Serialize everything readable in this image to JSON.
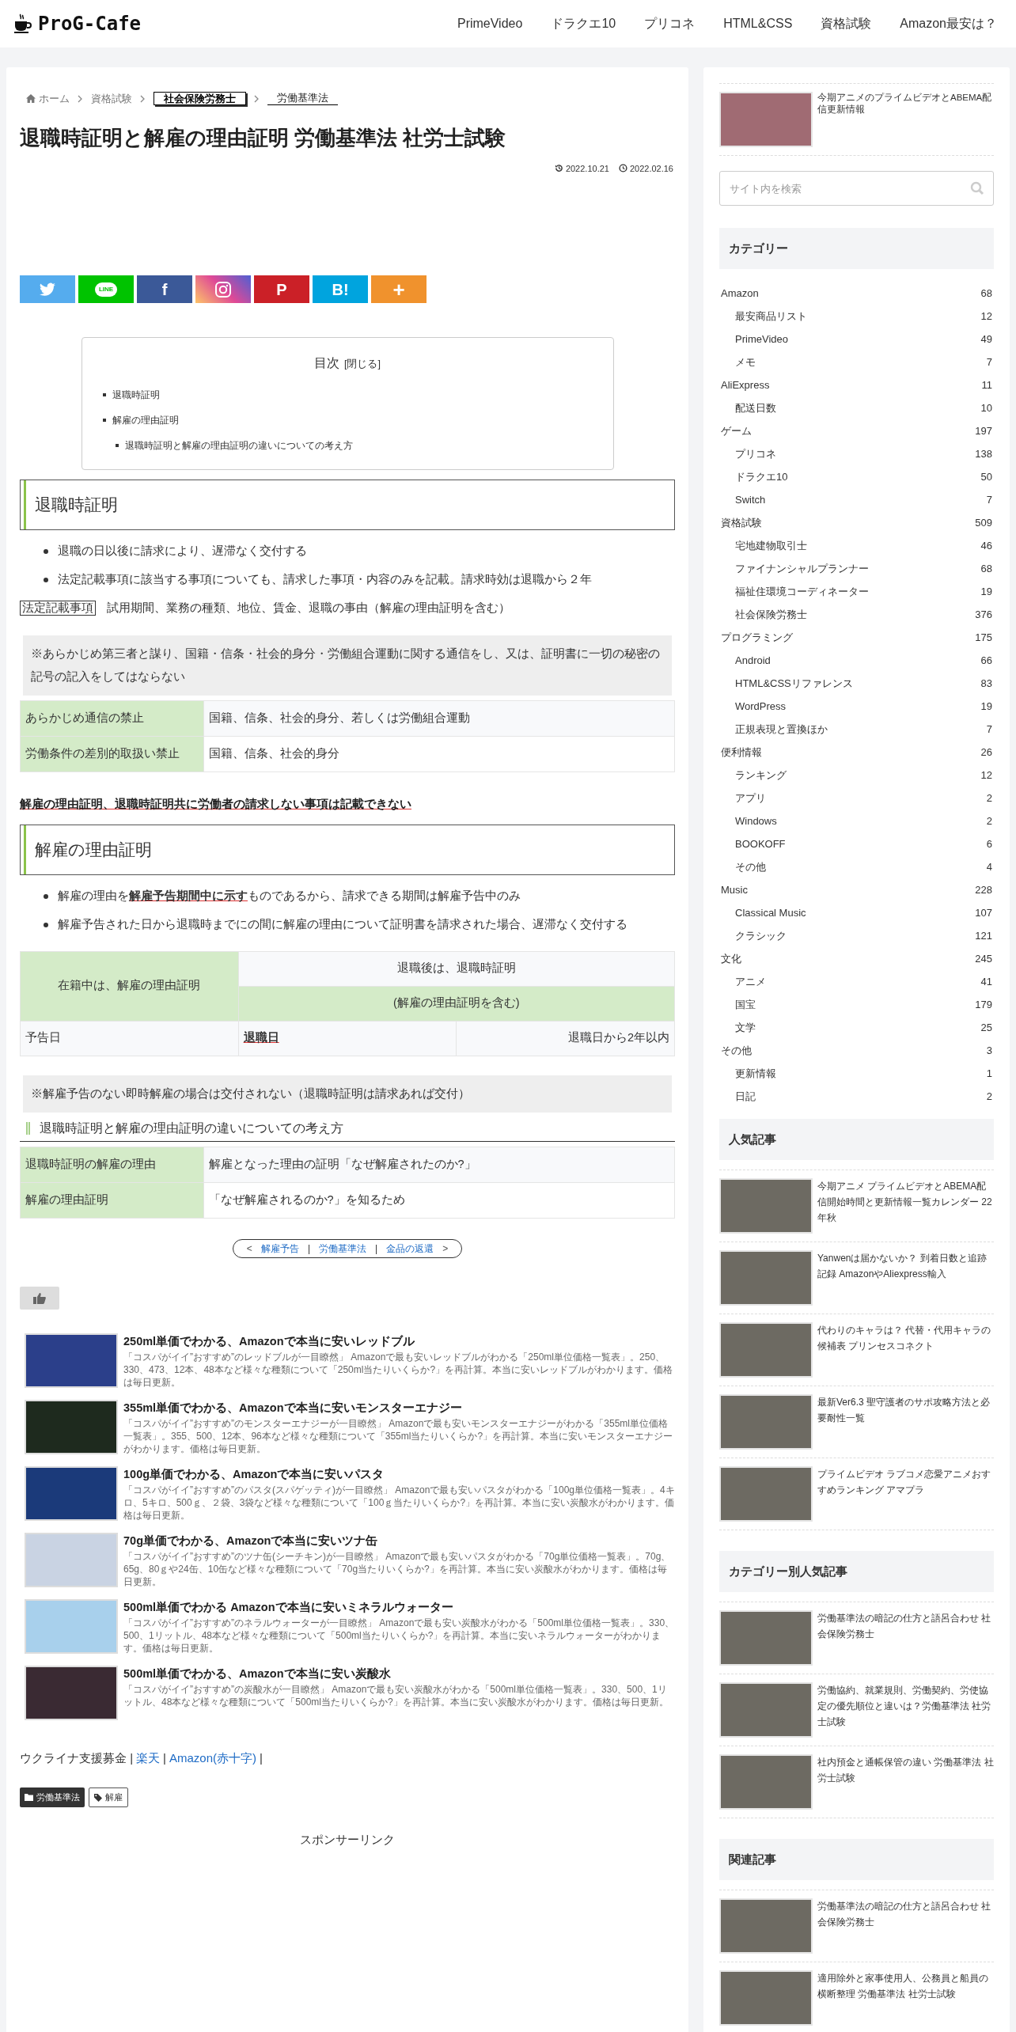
{
  "header": {
    "logo": "ProG-Cafe",
    "nav": [
      "PrimeVideo",
      "ドラクエ10",
      "プリコネ",
      "HTML&CSS",
      "資格試験",
      "Amazon最安は？"
    ]
  },
  "breadcrumb": [
    {
      "kind": "home",
      "label": "ホーム"
    },
    {
      "kind": "link",
      "label": "資格試験"
    },
    {
      "kind": "boxed",
      "label": "社会保険労務士"
    },
    {
      "kind": "underlined",
      "label": "労働基準法"
    }
  ],
  "title": "退職時証明と解雇の理由証明 労働基準法 社労士試験",
  "updated": "2022.10.21",
  "published": "2022.02.16",
  "share": [
    {
      "kind": "twitter"
    },
    {
      "kind": "line",
      "label": "LINE"
    },
    {
      "kind": "facebook",
      "label": "f"
    },
    {
      "kind": "instagram"
    },
    {
      "kind": "pinterest",
      "label": "P"
    },
    {
      "kind": "hatena",
      "label": "B!"
    },
    {
      "kind": "more",
      "label": "+"
    }
  ],
  "toc": {
    "title": "目次",
    "toggle": "[閉じる]",
    "items": [
      {
        "text": "退職時証明"
      },
      {
        "text": "解雇の理由証明",
        "children": [
          {
            "text": "退職時証明と解雇の理由証明の違いについての考え方"
          }
        ]
      }
    ]
  },
  "blocks": [
    {
      "kind": "h2",
      "text": "退職時証明"
    },
    {
      "kind": "bullets",
      "items": [
        "退職の日以後に請求により、遅滞なく交付する",
        "法定記載事項に該当する事項についても、請求した事項・内容のみを記載。請求時効は退職から２年"
      ]
    },
    {
      "kind": "labeled",
      "label": "法定記載事項",
      "text": "試用期間、業務の種類、地位、賃金、退職の事由（解雇の理由証明を含む）"
    },
    {
      "kind": "note",
      "text": "※あらかじめ第三者と謀り、国籍・信条・社会的身分・労働組合運動に関する通信をし、又は、証明書に一切の秘密の記号の記入をしてはならない"
    },
    {
      "kind": "table",
      "rows": [
        [
          "あらかじめ通信の禁止",
          "国籍、信条、社会的身分、若しくは労働組合運動"
        ],
        [
          "労働条件の差別的取扱い禁止",
          "国籍、信条、社会的身分"
        ]
      ]
    },
    {
      "kind": "emphasis",
      "text": "解雇の理由証明、退職時証明共に労働者の請求しない事項は記載できない"
    },
    {
      "kind": "h2",
      "text": "解雇の理由証明"
    },
    {
      "kind": "bullets",
      "items": [
        "解雇の理由を**解雇予告期間中に示す**ものであるから、請求できる期間は解雇予告中のみ",
        "解雇予告された日から退職時までにの間に解雇の理由について証明書を請求された場合、遅滞なく交付する"
      ]
    },
    {
      "kind": "span_table",
      "during": "在籍中は、解雇の理由証明",
      "after": "退職後は、退職時証明",
      "after_note": "(解雇の理由証明を含む)",
      "row": [
        "予告日",
        "退職日",
        "退職日から2年以内"
      ]
    },
    {
      "kind": "note",
      "text": "※解雇予告のない即時解雇の場合は交付されない（退職時証明は請求あれば交付）"
    },
    {
      "kind": "h3",
      "text": "退職時証明と解雇の理由証明の違いについての考え方"
    },
    {
      "kind": "table",
      "rows": [
        [
          "退職時証明の解雇の理由",
          "解雇となった理由の証明「なぜ解雇されたのか?」"
        ],
        [
          "解雇の理由証明",
          "「なぜ解雇されるのか?」を知るため"
        ]
      ]
    }
  ],
  "pager": [
    {
      "kind": "arrow",
      "text": "<"
    },
    {
      "kind": "link",
      "text": "解雇予告"
    },
    {
      "kind": "sep",
      "text": "|"
    },
    {
      "kind": "link",
      "text": "労働基準法"
    },
    {
      "kind": "sep",
      "text": "|"
    },
    {
      "kind": "link",
      "text": "金品の返還"
    },
    {
      "kind": "arrow",
      "text": ">"
    }
  ],
  "products": [
    {
      "title": "250ml単価でわかる、Amazonで本当に安いレッドブル",
      "description": "「コスパがイイ”おすすめ”のレッドブルが一目瞭然」 Amazonで最も安いレッドブルがわかる「250ml単位価格一覧表」。250、330、473、12本、48本など様々な種類について「250ml当たりいくらか?」を再計算。本当に安いレッドブルがわかります。価格は毎日更新。"
    },
    {
      "title": "355ml単価でわかる、Amazonで本当に安いモンスターエナジー",
      "description": "「コスパがイイ”おすすめ”のモンスターエナジーが一目瞭然」 Amazonで最も安いモンスターエナジーがわかる「355ml単位価格一覧表」。355、500、12本、96本など様々な種類について「355ml当たりいくらか?」を再計算。本当に安いモンスターエナジーがわかります。価格は毎日更新。"
    },
    {
      "title": "100g単価でわかる、Amazonで本当に安いパスタ",
      "description": "「コスパがイイ”おすすめ”のパスタ(スパゲッティ)が一目瞭然」 Amazonで最も安いパスタがわかる「100g単位価格一覧表」。4キロ、5キロ、500ｇ、２袋、3袋など様々な種類について「100ｇ当たりいくらか?」を再計算。本当に安い炭酸水がわかります。価格は毎日更新。"
    },
    {
      "title": "70g単価でわかる、Amazonで本当に安いツナ缶",
      "description": "「コスパがイイ”おすすめ”のツナ缶(シーチキン)が一目瞭然」 Amazonで最も安いパスタがわかる「70g単位価格一覧表」。70g、65g、80ｇや24缶、10缶など様々な種類について「70g当たりいくらか?」を再計算。本当に安い炭酸水がわかります。価格は毎日更新。"
    },
    {
      "title": "500ml単価でわかる Amazonで本当に安いミネラルウォーター",
      "description": "「コスパがイイ”おすすめ”のネラルウォーターが一目瞭然」 Amazonで最も安い炭酸水がわかる「500ml単位価格一覧表」。330、500、1リットル、48本など様々な種類について「500ml当たりいくらか?」を再計算。本当に安いネラルウォーターがわかります。価格は毎日更新。"
    },
    {
      "title": "500ml単価でわかる、Amazonで本当に安い炭酸水",
      "description": "「コスパがイイ”おすすめ”の炭酸水が一目瞭然」 Amazonで最も安い炭酸水がわかる「500ml単位価格一覧表」。330、500、1リットル、48本など様々な種類について「500ml当たりいくらか?」を再計算。本当に安い炭酸水がわかります。価格は毎日更新。"
    }
  ],
  "donation": [
    {
      "kind": "text",
      "text": "ウクライナ支援募金 |"
    },
    {
      "kind": "link",
      "text": "楽天"
    },
    {
      "kind": "text",
      "text": "|"
    },
    {
      "kind": "link",
      "text": "Amazon(赤十字)"
    },
    {
      "kind": "text",
      "text": "|"
    }
  ],
  "tags": [
    {
      "kind": "category",
      "label": "労働基準法"
    },
    {
      "kind": "tag",
      "label": "解雇"
    }
  ],
  "sponsor": "スポンサーリンク",
  "sidebar": {
    "top_post": "今期アニメのプライムビデオとABEMA配信更新情報",
    "search": {
      "placeholder": "サイト内を検索"
    },
    "categories_title": "カテゴリー",
    "categories": [
      {
        "name": "Amazon",
        "count": "68",
        "children": [
          {
            "name": "最安商品リスト",
            "count": "12"
          },
          {
            "name": "PrimeVideo",
            "count": "49"
          },
          {
            "name": "メモ",
            "count": "7"
          }
        ]
      },
      {
        "name": "AliExpress",
        "count": "11",
        "children": [
          {
            "name": "配送日数",
            "count": "10"
          }
        ]
      },
      {
        "name": "ゲーム",
        "count": "197",
        "children": [
          {
            "name": "プリコネ",
            "count": "138"
          },
          {
            "name": "ドラクエ10",
            "count": "50"
          },
          {
            "name": "Switch",
            "count": "7"
          }
        ]
      },
      {
        "name": "資格試験",
        "count": "509",
        "children": [
          {
            "name": "宅地建物取引士",
            "count": "46"
          },
          {
            "name": "ファイナンシャルプランナー",
            "count": "68"
          },
          {
            "name": "福祉住環境コーディネーター",
            "count": "19"
          },
          {
            "name": "社会保険労務士",
            "count": "376"
          }
        ]
      },
      {
        "name": "プログラミング",
        "count": "175",
        "children": [
          {
            "name": "Android",
            "count": "66"
          },
          {
            "name": "HTML&CSSリファレンス",
            "count": "83"
          },
          {
            "name": "WordPress",
            "count": "19"
          },
          {
            "name": "正規表現と置換ほか",
            "count": "7"
          }
        ]
      },
      {
        "name": "便利情報",
        "count": "26",
        "children": [
          {
            "name": "ランキング",
            "count": "12"
          },
          {
            "name": "アプリ",
            "count": "2"
          },
          {
            "name": "Windows",
            "count": "2"
          },
          {
            "name": "BOOKOFF",
            "count": "6"
          },
          {
            "name": "その他",
            "count": "4"
          }
        ]
      },
      {
        "name": "Music",
        "count": "228",
        "children": [
          {
            "name": "Classical Music",
            "count": "107"
          },
          {
            "name": "クラシック",
            "count": "121"
          }
        ]
      },
      {
        "name": "文化",
        "count": "245",
        "children": [
          {
            "name": "アニメ",
            "count": "41"
          },
          {
            "name": "国宝",
            "count": "179"
          },
          {
            "name": "文学",
            "count": "25"
          }
        ]
      },
      {
        "name": "その他",
        "count": "3",
        "children": [
          {
            "name": "更新情報",
            "count": "1"
          },
          {
            "name": "日記",
            "count": "2"
          }
        ]
      }
    ],
    "sections": [
      {
        "title": "人気記事",
        "posts": [
          "今期アニメ プライムビデオとABEMA配信開始時間と更新情報一覧カレンダー 22年秋",
          "Yanwenは届かないか？ 到着日数と追跡記録 AmazonやAliexpress輸入",
          "代わりのキャラは？ 代替・代用キャラの候補表 プリンセスコネクト",
          "最新Ver6.3 聖守護者のサポ攻略方法と必要耐性一覧",
          "プライムビデオ ラブコメ恋愛アニメおすすめランキング アマプラ"
        ]
      },
      {
        "title": "カテゴリー別人気記事",
        "posts": [
          "労働基準法の暗記の仕方と語呂合わせ 社会保険労務士",
          "労働協約、就業規則、労働契約、労使協定の優先順位と違いは？労働基準法 社労士試験",
          "社内預金と通帳保管の違い 労働基準法 社労士試験"
        ]
      },
      {
        "title": "関連記事",
        "posts": [
          "労働基準法の暗記の仕方と語呂合わせ 社会保険労務士",
          "適用除外と家事使用人、公務員と船員の横断整理 労働基準法 社労士試験"
        ]
      }
    ]
  }
}
